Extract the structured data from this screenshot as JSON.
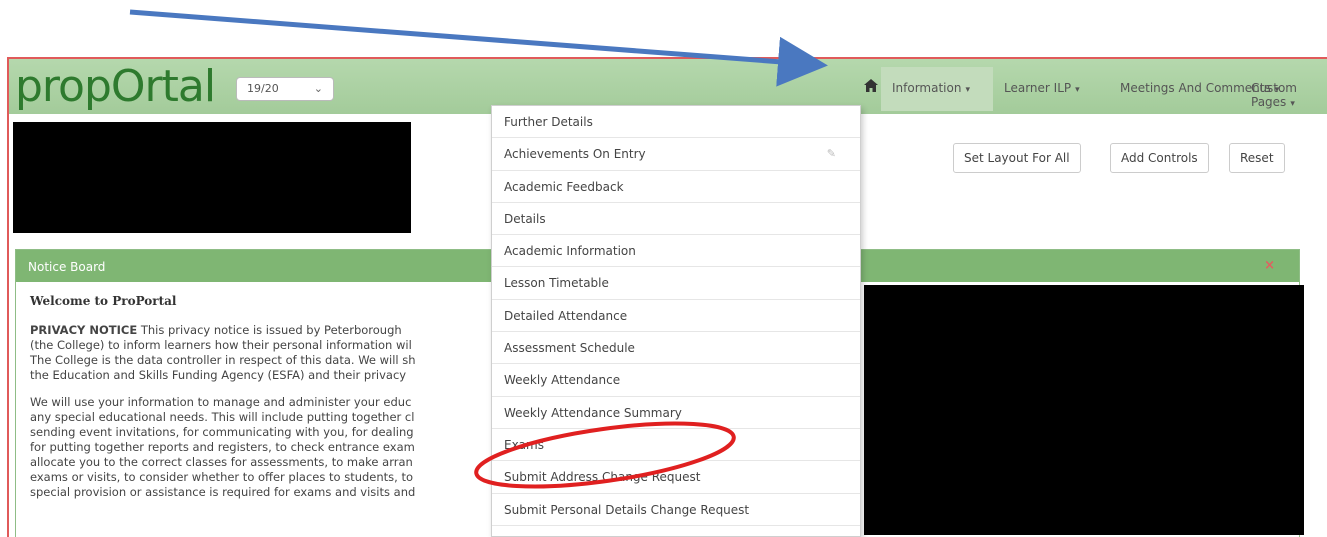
{
  "app": {
    "logo_text": "propOrtal",
    "year_select": "19/20"
  },
  "nav": {
    "home_icon": "home-icon",
    "items": [
      {
        "label": "Information"
      },
      {
        "label": "Learner ILP"
      },
      {
        "label": "Meetings And Comments"
      },
      {
        "label": "Custom Pages"
      }
    ]
  },
  "layout_buttons": {
    "set_layout": "Set Layout For All",
    "add_controls": "Add Controls",
    "reset": "Reset"
  },
  "dropdown": {
    "items": [
      "Further Details",
      "Achievements On Entry",
      "Academic Feedback",
      "Details",
      "Academic Information",
      "Lesson Timetable",
      "Detailed Attendance",
      "Assessment Schedule",
      "Weekly Attendance",
      "Weekly Attendance Summary",
      "Exams",
      "Submit Address Change Request",
      "Submit Personal Details Change Request"
    ]
  },
  "notice_board": {
    "title": "Notice Board",
    "close": "×",
    "welcome": "Welcome to ProPortal",
    "privacy_heading": "PRIVACY NOTICE",
    "privacy_text": " This privacy notice is issued by Peterborough\n(the College) to inform learners how their personal information wil\nThe College is the data controller in respect of this data. We will sh\nthe Education and Skills Funding Agency (ESFA) and their privacy",
    "use_text": "We will use your information to manage and administer your educ\nany special educational needs. This will include putting together cl\nsending event invitations, for communicating with you, for dealing\nfor putting together reports and registers, to check entrance exam\nallocate you to the correct classes for assessments, to make arran\nexams or visits, to consider whether to offer places to students, to\nspecial provision or assistance is required for exams and visits and"
  },
  "colors": {
    "navbar": "#a8d0a0",
    "panel_header": "#7fb673",
    "logo": "#2e7a2e",
    "frame_border": "#e05a5a",
    "annotation_arrow": "#4a78c0",
    "annotation_circle": "#e02020"
  }
}
